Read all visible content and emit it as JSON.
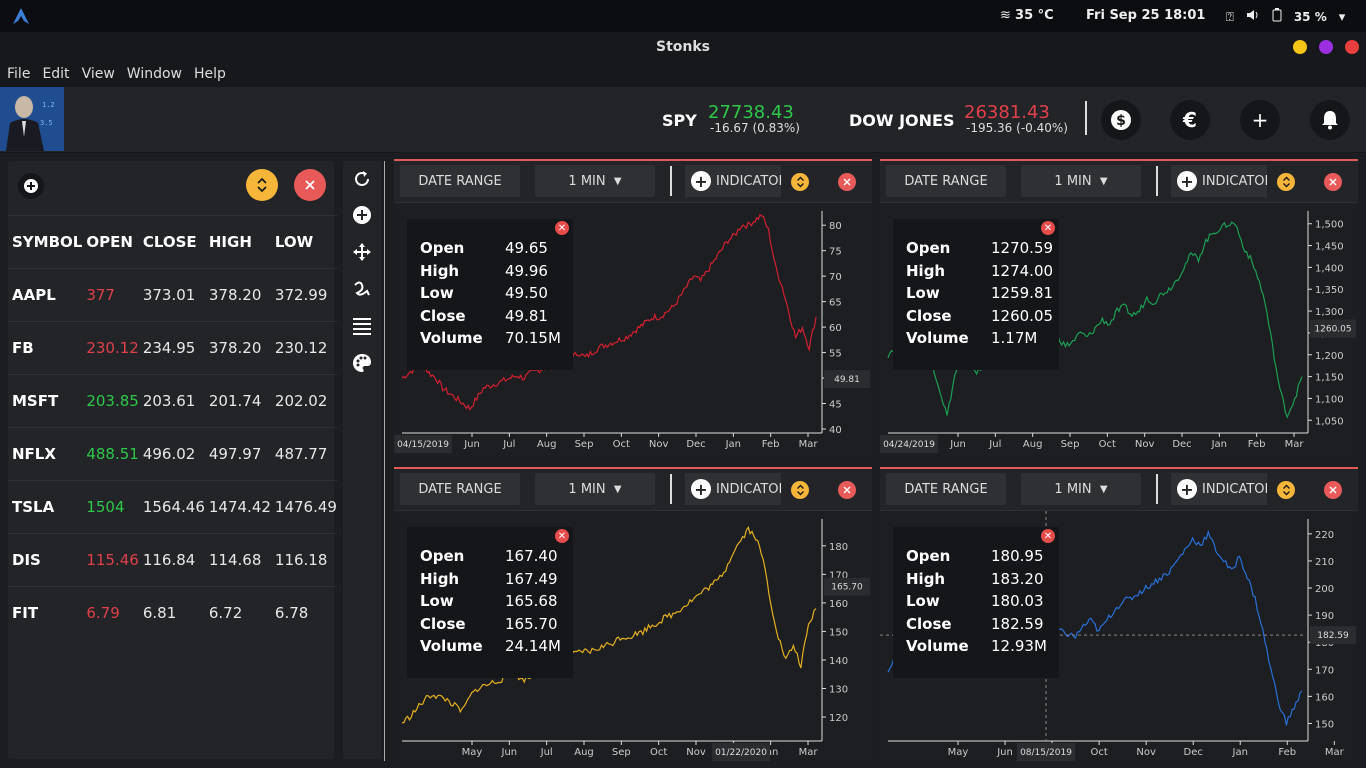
{
  "topbar": {
    "temperature": "35 °C",
    "datetime": "Fri Sep 25  18:01",
    "battery": "35 %"
  },
  "window": {
    "title": "Stonks"
  },
  "menu": [
    "File",
    "Edit",
    "View",
    "Window",
    "Help"
  ],
  "header": {
    "tickers": [
      {
        "name": "SPY",
        "value": "27738.43",
        "change": "-16.67 (0.83%)",
        "color": "#2ec84a"
      },
      {
        "name": "DOW JONES",
        "value": "26381.43",
        "change": "-195.36 (-0.40%)",
        "color": "#e0404a"
      }
    ],
    "buttons": [
      "dollar-icon",
      "euro-icon",
      "plus-icon",
      "bell-icon"
    ]
  },
  "quotes": {
    "columns": [
      "SYMBOL",
      "OPEN",
      "CLOSE",
      "HIGH",
      "LOW"
    ],
    "rows": [
      {
        "symbol": "AAPL",
        "open": "377",
        "open_color": "#e0404a",
        "close": "373.01",
        "high": "378.20",
        "low": "372.99"
      },
      {
        "symbol": "FB",
        "open": "230.12",
        "open_color": "#e0404a",
        "close": "234.95",
        "high": "378.20",
        "low": "230.12"
      },
      {
        "symbol": "MSFT",
        "open": "203.85",
        "open_color": "#2ec84a",
        "close": "203.61",
        "high": "201.74",
        "low": "202.02"
      },
      {
        "symbol": "NFLX",
        "open": "488.51",
        "open_color": "#2ec84a",
        "close": "496.02",
        "high": "497.97",
        "low": "487.77"
      },
      {
        "symbol": "TSLA",
        "open": "1504",
        "open_color": "#2ec84a",
        "close": "1564.46",
        "high": "1474.42",
        "low": "1476.49"
      },
      {
        "symbol": "DIS",
        "open": "115.46",
        "open_color": "#e0404a",
        "close": "116.84",
        "high": "114.68",
        "low": "116.18"
      },
      {
        "symbol": "FIT",
        "open": "6.79",
        "open_color": "#e0404a",
        "close": "6.81",
        "high": "6.72",
        "low": "6.78"
      }
    ]
  },
  "toolbar": [
    "refresh-icon",
    "add-icon",
    "move-icon",
    "draw-icon",
    "list-icon",
    "palette-icon"
  ],
  "chart_bar": {
    "date_range": "DATE RANGE",
    "interval": "1 MIN",
    "indicators": "INDICATORS"
  },
  "ohlc_labels": [
    "Open",
    "High",
    "Low",
    "Close",
    "Volume"
  ],
  "charts": [
    {
      "color": "#d22030",
      "months": [
        "Jun",
        "Jul",
        "Aug",
        "Sep",
        "Oct",
        "Nov",
        "Dec",
        "Jan",
        "Feb",
        "Mar"
      ],
      "start_date": "04/15/2019",
      "yticks": [
        "80",
        "75",
        "70",
        "65",
        "60",
        "55",
        "50",
        "45",
        "40"
      ],
      "ylim": [
        40,
        82
      ],
      "price_label": "49.81",
      "price": 49.81,
      "ohlc": [
        "49.65",
        "49.96",
        "49.50",
        "49.81",
        "70.15M"
      ],
      "series": [
        50,
        51,
        52,
        52.5,
        51,
        50,
        48,
        47,
        46,
        45,
        44,
        46,
        48,
        48.5,
        49,
        49.5,
        50,
        50.5,
        50,
        51,
        51.5,
        52,
        52,
        53,
        53.5,
        54,
        55,
        54,
        55,
        56,
        56.5,
        57,
        57.5,
        58,
        59,
        60,
        61,
        62,
        62,
        63,
        64,
        66,
        68,
        70,
        69,
        71,
        73,
        75,
        77,
        78,
        80,
        80,
        81,
        82,
        79,
        72,
        68,
        63,
        58,
        60,
        56,
        62
      ]
    },
    {
      "color": "#1e9e54",
      "months": [
        "Jun",
        "Jul",
        "Aug",
        "Sep",
        "Oct",
        "Nov",
        "Dec",
        "Jan",
        "Feb",
        "Mar"
      ],
      "start_date": "04/24/2019",
      "yticks": [
        "1,500",
        "1,450",
        "1,400",
        "1,350",
        "1,300",
        "1,250",
        "1,200",
        "1,150",
        "1,100",
        "1,050"
      ],
      "ylim": [
        1030,
        1520
      ],
      "price_label": "1260.05",
      "price": 1260.05,
      "ohlc": [
        "1270.59",
        "1274.00",
        "1259.81",
        "1260.05",
        "1.17M"
      ],
      "series": [
        1200,
        1220,
        1250,
        1240,
        1280,
        1250,
        1180,
        1120,
        1060,
        1150,
        1200,
        1180,
        1160,
        1170,
        1180,
        1210,
        1220,
        1230,
        1260,
        1240,
        1200,
        1210,
        1230,
        1240,
        1220,
        1230,
        1250,
        1240,
        1260,
        1280,
        1270,
        1300,
        1310,
        1290,
        1300,
        1330,
        1320,
        1340,
        1350,
        1370,
        1400,
        1430,
        1420,
        1460,
        1480,
        1490,
        1500,
        1500,
        1450,
        1420,
        1380,
        1320,
        1220,
        1120,
        1060,
        1100,
        1150
      ]
    },
    {
      "color": "#e4b020",
      "months": [
        "May",
        "Jun",
        "Jul",
        "Aug",
        "Sep",
        "Oct",
        "Nov",
        "Dec",
        "Jan",
        "Mar"
      ],
      "start_date": "01/22/2020",
      "yticks": [
        "180",
        "170",
        "160",
        "150",
        "140",
        "130",
        "120"
      ],
      "ylim": [
        113,
        188
      ],
      "price_label": "165.70",
      "price": 165.7,
      "ohlc": [
        "167.40",
        "167.49",
        "165.68",
        "165.70",
        "24.14M"
      ],
      "series": [
        118,
        120,
        123,
        126,
        128,
        127,
        126,
        124,
        122,
        127,
        130,
        131,
        132,
        133,
        134,
        135,
        133,
        134,
        136,
        138,
        139,
        140,
        141,
        142,
        143,
        143,
        144,
        145,
        146,
        148,
        148,
        149,
        150,
        152,
        153,
        155,
        156,
        158,
        160,
        162,
        164,
        166,
        168,
        172,
        178,
        182,
        186,
        183,
        175,
        160,
        148,
        140,
        145,
        138,
        152,
        158
      ]
    },
    {
      "color": "#2a6fd8",
      "months": [
        "May",
        "Jun",
        "Jul",
        "Oct",
        "Nov",
        "Dec",
        "Jan",
        "Feb",
        "Mar"
      ],
      "start_date": "08/15/2019",
      "yticks": [
        "220",
        "210",
        "200",
        "190",
        "180",
        "170",
        "160",
        "150"
      ],
      "ylim": [
        145,
        224
      ],
      "price_label": "182.59",
      "price": 182.59,
      "ohlc": [
        "180.95",
        "183.20",
        "180.03",
        "182.59",
        "12.93M"
      ],
      "series": [
        170,
        175,
        178,
        185,
        190,
        186,
        180,
        178,
        175,
        182,
        186,
        188,
        190,
        192,
        190,
        186,
        190,
        184,
        188,
        186,
        182,
        188,
        184,
        183,
        182,
        186,
        188,
        184,
        188,
        192,
        195,
        196,
        198,
        200,
        202,
        204,
        206,
        210,
        214,
        218,
        216,
        220,
        214,
        210,
        206,
        212,
        204,
        196,
        184,
        170,
        158,
        150,
        156,
        162
      ]
    }
  ]
}
